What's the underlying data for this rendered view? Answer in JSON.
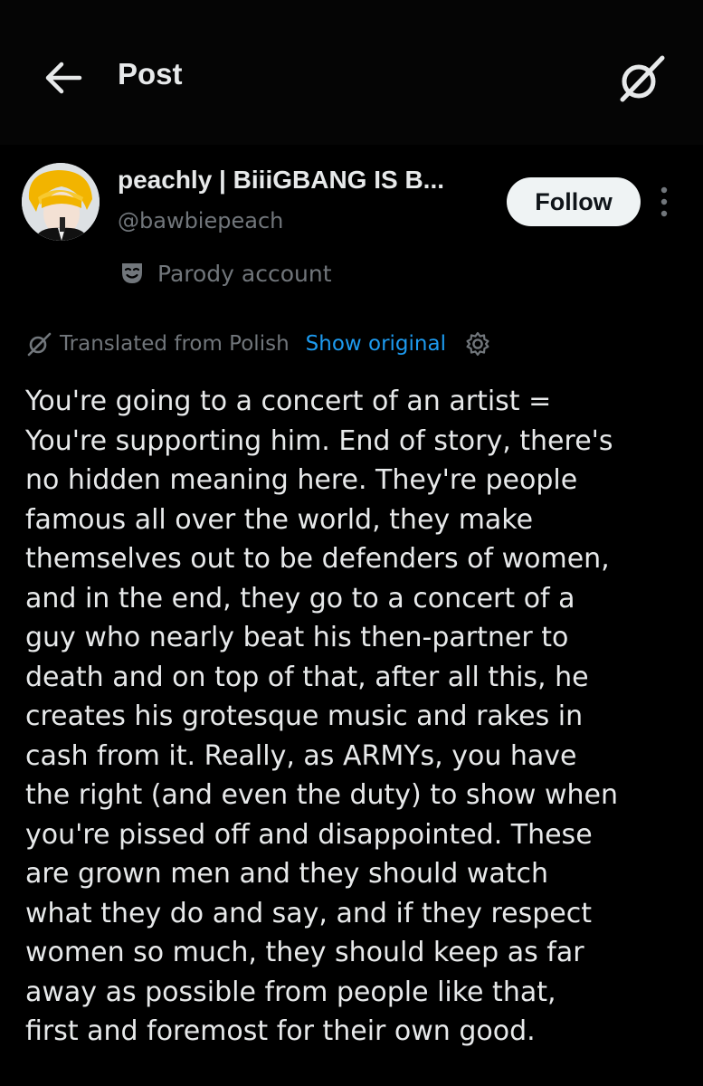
{
  "header": {
    "title": "Post",
    "back_icon": "arrow-left-icon",
    "grok_icon": "grok-icon"
  },
  "author": {
    "display_name": "peachly | BiiiGBANG IS B...",
    "handle": "@bawbiepeach",
    "follow_label": "Follow",
    "badge_icon": "mask-icon",
    "badge_label": "Parody account"
  },
  "translation": {
    "label": "Translated from Polish",
    "show_original": "Show original",
    "settings_icon": "gear-icon"
  },
  "post": {
    "lines": [
      "You're going to a concert of an artist =",
      "You're supporting him. End of story, there's",
      "no hidden meaning here. They're people",
      "famous all over the world, they make",
      "themselves out to be defenders of women,",
      "and in the end, they go to a concert of a",
      "guy who nearly beat his then-partner to",
      "death and on top of that, after all this, he",
      "creates his grotesque music and rakes in",
      "cash from it. Really, as ARMYs, you have",
      "the right (and even the duty) to show when",
      "you're pissed off and disappointed. These",
      "are grown men and they should watch",
      "what they do and say, and if they respect",
      "women so much, they should keep as far",
      "away as possible from people like that,",
      "first and foremost for their own good."
    ]
  },
  "colors": {
    "background": "#000000",
    "text_primary": "#e7e9ea",
    "text_secondary": "#71767b",
    "link": "#1d9bf0",
    "follow_bg": "#eff3f4"
  }
}
